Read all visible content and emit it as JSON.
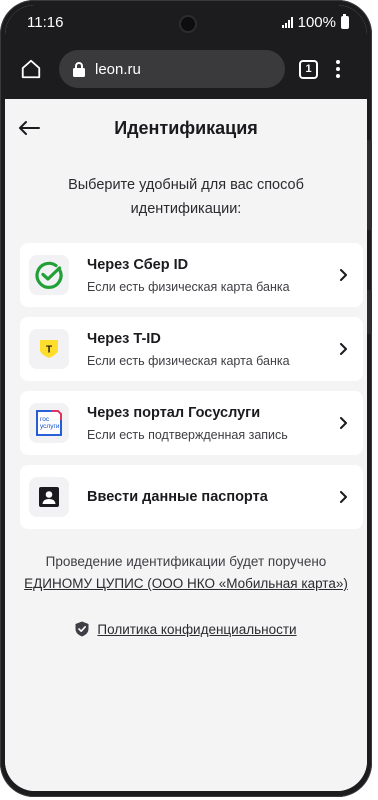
{
  "status": {
    "time": "11:16",
    "battery": "100%"
  },
  "browser": {
    "url": "leon.ru",
    "tab_count": "1"
  },
  "header": {
    "title": "Идентификация"
  },
  "subtitle": "Выберите удобный для вас способ идентификации:",
  "options": [
    {
      "title": "Через Сбер ID",
      "desc": "Если есть физическая карта банка",
      "icon": "sber-icon"
    },
    {
      "title": "Через T-ID",
      "desc": "Если есть физическая карта банка",
      "icon": "tbank-icon",
      "icon_text": "T"
    },
    {
      "title": "Через портал Госуслуги",
      "desc": "Если есть подтвержденная запись",
      "icon": "gosuslugi-icon",
      "icon_text": [
        "гос",
        "услуги"
      ]
    },
    {
      "title": "Ввести данные паспорта",
      "desc": "",
      "icon": "passport-icon"
    }
  ],
  "footer": {
    "line1": "Проведение идентификации будет поручено",
    "link": "ЕДИНОМУ ЦУПИС (ООО НКО «Мобильная карта»)",
    "privacy": "Политика конфиденциальности"
  },
  "colors": {
    "sber_green": "#21a038",
    "tbank_yellow": "#ffdd2d",
    "gosuslugi_blue": "#0d4cd3",
    "gosuslugi_red": "#ee2f53"
  }
}
